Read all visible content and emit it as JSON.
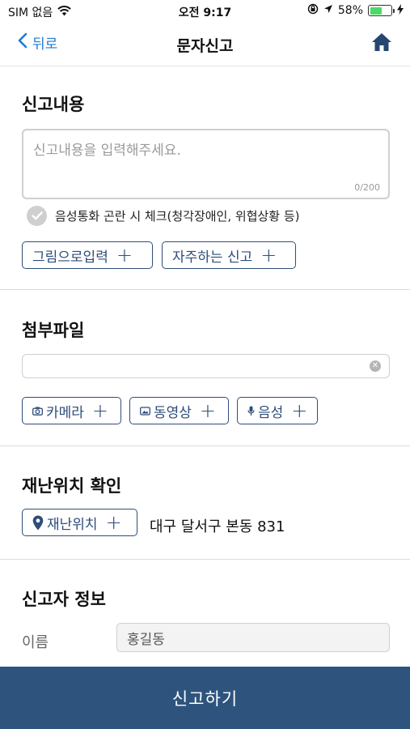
{
  "status_bar": {
    "carrier": "SIM 없음",
    "time": "오전 9:17",
    "battery": "58%",
    "battery_level": 0.58,
    "icons": [
      "wifi-icon",
      "lock-rotation-icon",
      "location-arrow-icon",
      "battery-icon",
      "charging-icon"
    ]
  },
  "nav": {
    "back_label": "뒤로",
    "title": "문자신고",
    "home_icon": "home-icon",
    "accent_color": "#1e7ad6"
  },
  "report": {
    "section_title": "신고내용",
    "placeholder": "신고내용을 입력해주세요.",
    "value": "",
    "counter": "0/200",
    "checkbox_label": "음성통화 곤란 시 체크(청각장애인, 위협상황 등)",
    "checkbox_checked": false,
    "buttons": [
      {
        "label": "그림으로입력"
      },
      {
        "label": "자주하는 신고"
      }
    ]
  },
  "attachment": {
    "section_title": "첨부파일",
    "value": "",
    "buttons": [
      {
        "label": "카메라",
        "icon": "camera-icon"
      },
      {
        "label": "동영상",
        "icon": "video-icon"
      },
      {
        "label": "음성",
        "icon": "microphone-icon"
      }
    ]
  },
  "location": {
    "section_title": "재난위치 확인",
    "button_label": "재난위치",
    "button_icon": "map-pin-icon",
    "address": "대구 달서구 본동 831"
  },
  "reporter": {
    "section_title": "신고자 정보",
    "name_label": "이름",
    "name_value": "홍길동"
  },
  "submit": {
    "label": "신고하기",
    "color": "#2e547e"
  }
}
